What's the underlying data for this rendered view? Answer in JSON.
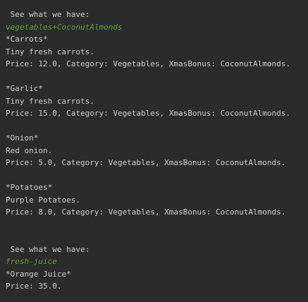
{
  "console": {
    "blocks": [
      {
        "header": " See what we have:",
        "subtitle": "vegetables+CoconutAlmonds",
        "items": [
          {
            "name": "*Carrots*",
            "description": "Tiny fresh carrots.",
            "details": "Price: 12.0, Category: Vegetables, XmasBonus: CoconutAlmonds."
          },
          {
            "name": "*Garlic*",
            "description": "Tiny fresh carrots.",
            "details": "Price: 15.0, Category: Vegetables, XmasBonus: CoconutAlmonds."
          },
          {
            "name": "*Onion*",
            "description": "Red onion.",
            "details": "Price: 5.0, Category: Vegetables, XmasBonus: CoconutAlmonds."
          },
          {
            "name": "*Potatoes*",
            "description": "Purple Potatoes.",
            "details": "Price: 8.0, Category: Vegetables, XmasBonus: CoconutAlmonds."
          }
        ]
      },
      {
        "header": " See what we have:",
        "subtitle": "fresh-juice",
        "items": [
          {
            "name": "*Orange Juice*",
            "details": "Price: 35.0."
          }
        ]
      }
    ]
  }
}
